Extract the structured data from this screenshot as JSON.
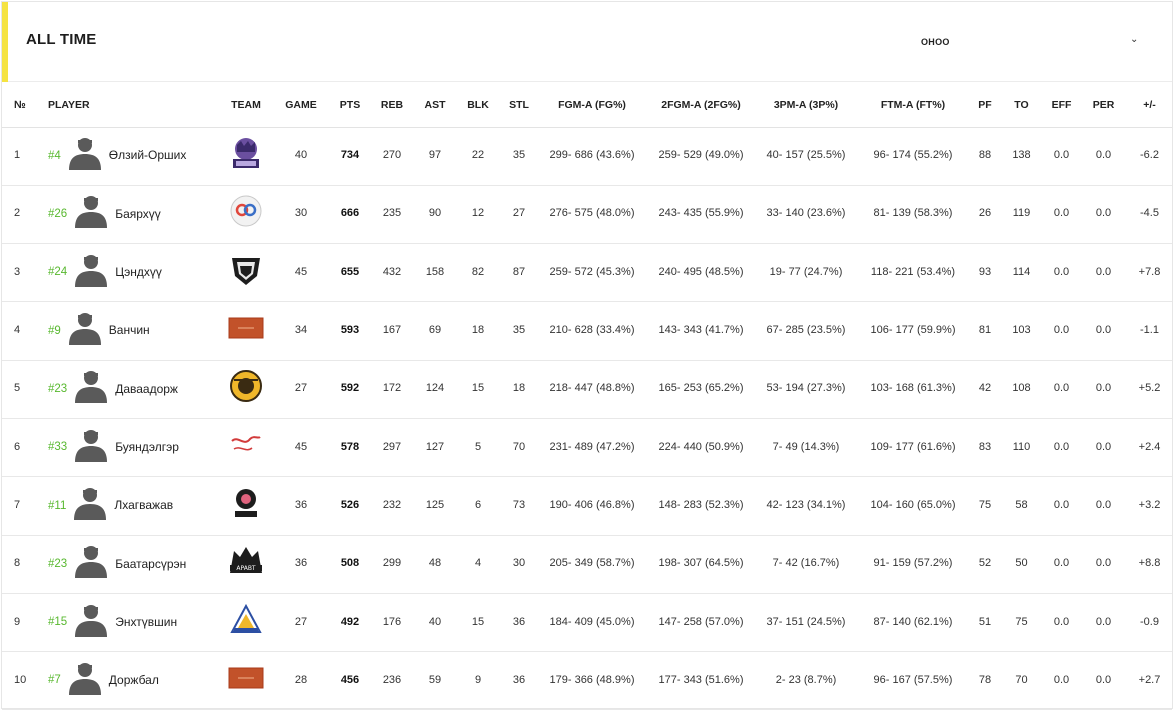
{
  "header": {
    "title": "ALL TIME",
    "select_value": "ОНОО"
  },
  "columns": [
    "№",
    "PLAYER",
    "TEAM",
    "GAME",
    "PTS",
    "REB",
    "AST",
    "BLK",
    "STL",
    "FGM-A (FG%)",
    "2FGM-A (2FG%)",
    "3PM-A (3P%)",
    "FTM-A (FT%)",
    "PF",
    "TO",
    "EFF",
    "PER",
    "+/-"
  ],
  "rows": [
    {
      "rank": "1",
      "number": "#4",
      "name": "Өлзий-Орших",
      "team_logo": "tigers-logo",
      "game": "40",
      "pts": "734",
      "reb": "270",
      "ast": "97",
      "blk": "22",
      "stl": "35",
      "fg": "299- 686 (43.6%)",
      "fg2": "259- 529 (49.0%)",
      "fg3": "40- 157 (25.5%)",
      "ft": "96- 174 (55.2%)",
      "pf": "88",
      "to": "138",
      "eff": "0.0",
      "per": "0.0",
      "pm": "-6.2"
    },
    {
      "rank": "2",
      "number": "#26",
      "name": "Баярхүү",
      "team_logo": "ninety-logo",
      "game": "30",
      "pts": "666",
      "reb": "235",
      "ast": "90",
      "blk": "12",
      "stl": "27",
      "fg": "276- 575 (48.0%)",
      "fg2": "243- 435 (55.9%)",
      "fg3": "33- 140 (23.6%)",
      "ft": "81- 139 (58.3%)",
      "pf": "26",
      "to": "119",
      "eff": "0.0",
      "per": "0.0",
      "pm": "-4.5"
    },
    {
      "rank": "3",
      "number": "#24",
      "name": "Цэндхүү",
      "team_logo": "shield-logo",
      "game": "45",
      "pts": "655",
      "reb": "432",
      "ast": "158",
      "blk": "82",
      "stl": "87",
      "fg": "259- 572 (45.3%)",
      "fg2": "240- 495 (48.5%)",
      "fg3": "19- 77 (24.7%)",
      "ft": "118- 221 (53.4%)",
      "pf": "93",
      "to": "114",
      "eff": "0.0",
      "per": "0.0",
      "pm": "+7.8"
    },
    {
      "rank": "4",
      "number": "#9",
      "name": "Ванчин",
      "team_logo": "banner-logo",
      "game": "34",
      "pts": "593",
      "reb": "167",
      "ast": "69",
      "blk": "18",
      "stl": "35",
      "fg": "210- 628 (33.4%)",
      "fg2": "143- 343 (41.7%)",
      "fg3": "67- 285 (23.5%)",
      "ft": "106- 177 (59.9%)",
      "pf": "81",
      "to": "103",
      "eff": "0.0",
      "per": "0.0",
      "pm": "-1.1"
    },
    {
      "rank": "5",
      "number": "#23",
      "name": "Даваадорж",
      "team_logo": "badge-logo",
      "game": "27",
      "pts": "592",
      "reb": "172",
      "ast": "124",
      "blk": "15",
      "stl": "18",
      "fg": "218- 447 (48.8%)",
      "fg2": "165- 253 (65.2%)",
      "fg3": "53- 194 (27.3%)",
      "ft": "103- 168 (61.3%)",
      "pf": "42",
      "to": "108",
      "eff": "0.0",
      "per": "0.0",
      "pm": "+5.2"
    },
    {
      "rank": "6",
      "number": "#33",
      "name": "Буяндэлгэр",
      "team_logo": "script-logo",
      "game": "45",
      "pts": "578",
      "reb": "297",
      "ast": "127",
      "blk": "5",
      "stl": "70",
      "fg": "231- 489 (47.2%)",
      "fg2": "224- 440 (50.9%)",
      "fg3": "7- 49 (14.3%)",
      "ft": "109- 177 (61.6%)",
      "pf": "83",
      "to": "110",
      "eff": "0.0",
      "per": "0.0",
      "pm": "+2.4"
    },
    {
      "rank": "7",
      "number": "#11",
      "name": "Лхагважав",
      "team_logo": "dark-crest-logo",
      "game": "36",
      "pts": "526",
      "reb": "232",
      "ast": "125",
      "blk": "6",
      "stl": "73",
      "fg": "190- 406 (46.8%)",
      "fg2": "148- 283 (52.3%)",
      "fg3": "42- 123 (34.1%)",
      "ft": "104- 160 (65.0%)",
      "pf": "75",
      "to": "58",
      "eff": "0.0",
      "per": "0.0",
      "pm": "+3.2"
    },
    {
      "rank": "8",
      "number": "#23",
      "name": "Баатарсүрэн",
      "team_logo": "aravt-logo",
      "game": "36",
      "pts": "508",
      "reb": "299",
      "ast": "48",
      "blk": "4",
      "stl": "30",
      "fg": "205- 349 (58.7%)",
      "fg2": "198- 307 (64.5%)",
      "fg3": "7- 42 (16.7%)",
      "ft": "91- 159 (57.2%)",
      "pf": "52",
      "to": "50",
      "eff": "0.0",
      "per": "0.0",
      "pm": "+8.8"
    },
    {
      "rank": "9",
      "number": "#15",
      "name": "Энхтүвшин",
      "team_logo": "triangle-logo",
      "game": "27",
      "pts": "492",
      "reb": "176",
      "ast": "40",
      "blk": "15",
      "stl": "36",
      "fg": "184- 409 (45.0%)",
      "fg2": "147- 258 (57.0%)",
      "fg3": "37- 151 (24.5%)",
      "ft": "87- 140 (62.1%)",
      "pf": "51",
      "to": "75",
      "eff": "0.0",
      "per": "0.0",
      "pm": "-0.9"
    },
    {
      "rank": "10",
      "number": "#7",
      "name": "Доржбал",
      "team_logo": "banner-logo",
      "game": "28",
      "pts": "456",
      "reb": "236",
      "ast": "59",
      "blk": "9",
      "stl": "36",
      "fg": "179- 366 (48.9%)",
      "fg2": "177- 343 (51.6%)",
      "fg3": "2- 23 (8.7%)",
      "ft": "96- 167 (57.5%)",
      "pf": "78",
      "to": "70",
      "eff": "0.0",
      "per": "0.0",
      "pm": "+2.7"
    }
  ],
  "colors": {
    "accent": "#f5e342",
    "jersey_number": "#58b82f",
    "avatar": "#5a5a5a"
  }
}
